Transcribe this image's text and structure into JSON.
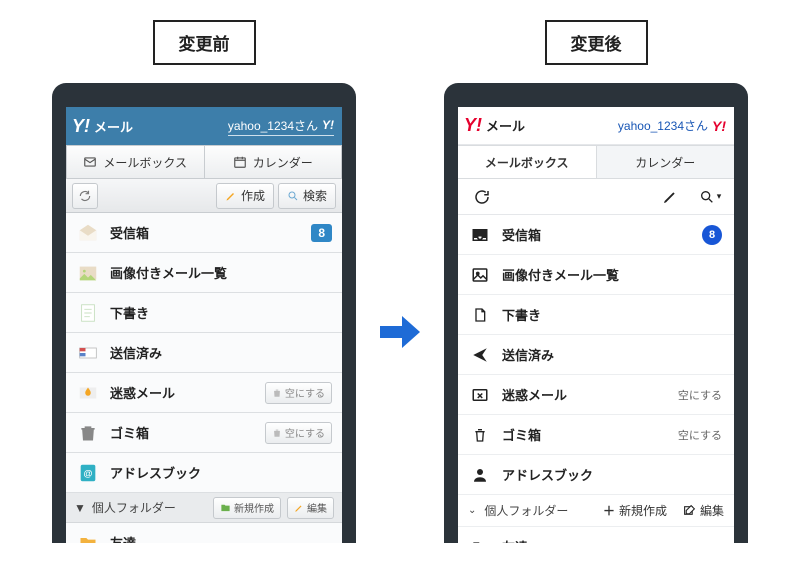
{
  "panels": {
    "before": {
      "title": "変更前"
    },
    "after": {
      "title": "変更後"
    }
  },
  "common": {
    "brand_mail": "メール",
    "user_label": "yahoo_1234さん",
    "tabs": {
      "mailbox": "メールボックス",
      "calendar": "カレンダー"
    },
    "compose": "作成",
    "search": "検索",
    "inbox_badge": "8",
    "folders": {
      "inbox": "受信箱",
      "images": "画像付きメール一覧",
      "drafts": "下書き",
      "sent": "送信済み",
      "spam": "迷惑メール",
      "trash": "ゴミ箱",
      "contacts": "アドレスブック"
    },
    "empty_btn": "空にする",
    "personal_folder_section": "個人フォルダー",
    "new_folder": "新規作成",
    "edit": "編集",
    "friends_folder": "友達"
  }
}
